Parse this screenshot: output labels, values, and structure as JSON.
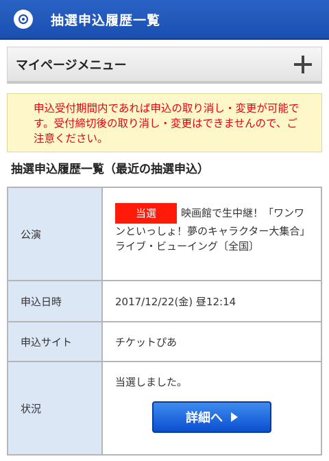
{
  "header": {
    "title": "抽選申込履歴一覧",
    "icon": "circle-icon"
  },
  "mypage_menu": {
    "label": "マイページメニュー",
    "icon": "plus-icon"
  },
  "notice": {
    "text": "申込受付期間内であれば申込の取り消し・変更が可能です。受付締切後の取り消し・変更はできませんので、ご注意ください。",
    "color": "#e60012"
  },
  "section_title": "抽選申込履歴一覧（最近の抽選申込）",
  "table": {
    "performance": {
      "label": "公演",
      "badge": "当選",
      "value": "映画館で生中継！「ワンワンといっしょ！夢のキャラクター大集合」ライブ・ビューイング〔全国〕"
    },
    "date": {
      "label": "申込日時",
      "value": "2017/12/22(金) 昼12:14"
    },
    "site": {
      "label": "申込サイト",
      "value": "チケットぴあ"
    },
    "status": {
      "label": "状況",
      "value": "当選しました。",
      "button_label": "詳細へ"
    }
  },
  "colors": {
    "header": "#1a4fb0",
    "badge": "#ff1a0a",
    "button": "#0b4fcf"
  }
}
